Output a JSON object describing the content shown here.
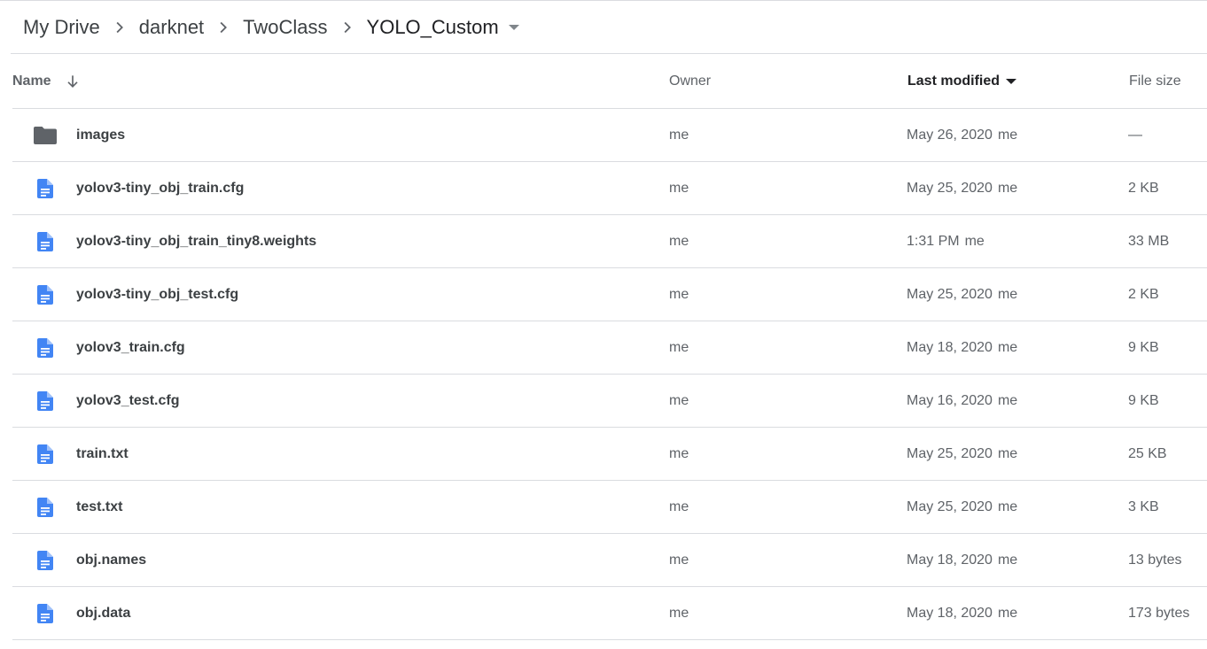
{
  "breadcrumb": {
    "items": [
      "My Drive",
      "darknet",
      "TwoClass",
      "YOLO_Custom"
    ]
  },
  "table": {
    "headers": {
      "name": "Name",
      "owner": "Owner",
      "last_modified": "Last modified",
      "file_size": "File size"
    },
    "rows": [
      {
        "icon": "folder-icon",
        "name": "images",
        "owner": "me",
        "modified": "May 26, 2020",
        "modified_by": "me",
        "size": "—"
      },
      {
        "icon": "doc-file-icon",
        "name": "yolov3-tiny_obj_train.cfg",
        "owner": "me",
        "modified": "May 25, 2020",
        "modified_by": "me",
        "size": "2 KB"
      },
      {
        "icon": "doc-file-icon",
        "name": "yolov3-tiny_obj_train_tiny8.weights",
        "owner": "me",
        "modified": "1:31 PM",
        "modified_by": "me",
        "size": "33 MB"
      },
      {
        "icon": "doc-file-icon",
        "name": "yolov3-tiny_obj_test.cfg",
        "owner": "me",
        "modified": "May 25, 2020",
        "modified_by": "me",
        "size": "2 KB"
      },
      {
        "icon": "doc-file-icon",
        "name": "yolov3_train.cfg",
        "owner": "me",
        "modified": "May 18, 2020",
        "modified_by": "me",
        "size": "9 KB"
      },
      {
        "icon": "doc-file-icon",
        "name": "yolov3_test.cfg",
        "owner": "me",
        "modified": "May 16, 2020",
        "modified_by": "me",
        "size": "9 KB"
      },
      {
        "icon": "doc-file-icon",
        "name": "train.txt",
        "owner": "me",
        "modified": "May 25, 2020",
        "modified_by": "me",
        "size": "25 KB"
      },
      {
        "icon": "doc-file-icon",
        "name": "test.txt",
        "owner": "me",
        "modified": "May 25, 2020",
        "modified_by": "me",
        "size": "3 KB"
      },
      {
        "icon": "doc-file-icon",
        "name": "obj.names",
        "owner": "me",
        "modified": "May 18, 2020",
        "modified_by": "me",
        "size": "13 bytes"
      },
      {
        "icon": "doc-file-icon",
        "name": "obj.data",
        "owner": "me",
        "modified": "May 18, 2020",
        "modified_by": "me",
        "size": "173 bytes"
      }
    ]
  },
  "colors": {
    "folder": "#5f6368",
    "doc": "#4285f4",
    "divider": "#dadce0"
  }
}
